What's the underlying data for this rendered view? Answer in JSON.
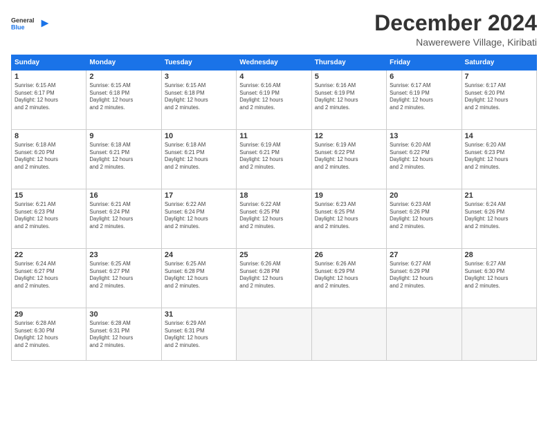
{
  "logo": {
    "general": "General",
    "blue": "Blue"
  },
  "title": {
    "month": "December 2024",
    "location": "Nawerewere Village, Kiribati"
  },
  "weekdays": [
    "Sunday",
    "Monday",
    "Tuesday",
    "Wednesday",
    "Thursday",
    "Friday",
    "Saturday"
  ],
  "weeks": [
    [
      {
        "day": "1",
        "info": "Sunrise: 6:15 AM\nSunset: 6:17 PM\nDaylight: 12 hours\nand 2 minutes."
      },
      {
        "day": "2",
        "info": "Sunrise: 6:15 AM\nSunset: 6:18 PM\nDaylight: 12 hours\nand 2 minutes."
      },
      {
        "day": "3",
        "info": "Sunrise: 6:15 AM\nSunset: 6:18 PM\nDaylight: 12 hours\nand 2 minutes."
      },
      {
        "day": "4",
        "info": "Sunrise: 6:16 AM\nSunset: 6:19 PM\nDaylight: 12 hours\nand 2 minutes."
      },
      {
        "day": "5",
        "info": "Sunrise: 6:16 AM\nSunset: 6:19 PM\nDaylight: 12 hours\nand 2 minutes."
      },
      {
        "day": "6",
        "info": "Sunrise: 6:17 AM\nSunset: 6:19 PM\nDaylight: 12 hours\nand 2 minutes."
      },
      {
        "day": "7",
        "info": "Sunrise: 6:17 AM\nSunset: 6:20 PM\nDaylight: 12 hours\nand 2 minutes."
      }
    ],
    [
      {
        "day": "8",
        "info": "Sunrise: 6:18 AM\nSunset: 6:20 PM\nDaylight: 12 hours\nand 2 minutes."
      },
      {
        "day": "9",
        "info": "Sunrise: 6:18 AM\nSunset: 6:21 PM\nDaylight: 12 hours\nand 2 minutes."
      },
      {
        "day": "10",
        "info": "Sunrise: 6:18 AM\nSunset: 6:21 PM\nDaylight: 12 hours\nand 2 minutes."
      },
      {
        "day": "11",
        "info": "Sunrise: 6:19 AM\nSunset: 6:21 PM\nDaylight: 12 hours\nand 2 minutes."
      },
      {
        "day": "12",
        "info": "Sunrise: 6:19 AM\nSunset: 6:22 PM\nDaylight: 12 hours\nand 2 minutes."
      },
      {
        "day": "13",
        "info": "Sunrise: 6:20 AM\nSunset: 6:22 PM\nDaylight: 12 hours\nand 2 minutes."
      },
      {
        "day": "14",
        "info": "Sunrise: 6:20 AM\nSunset: 6:23 PM\nDaylight: 12 hours\nand 2 minutes."
      }
    ],
    [
      {
        "day": "15",
        "info": "Sunrise: 6:21 AM\nSunset: 6:23 PM\nDaylight: 12 hours\nand 2 minutes."
      },
      {
        "day": "16",
        "info": "Sunrise: 6:21 AM\nSunset: 6:24 PM\nDaylight: 12 hours\nand 2 minutes."
      },
      {
        "day": "17",
        "info": "Sunrise: 6:22 AM\nSunset: 6:24 PM\nDaylight: 12 hours\nand 2 minutes."
      },
      {
        "day": "18",
        "info": "Sunrise: 6:22 AM\nSunset: 6:25 PM\nDaylight: 12 hours\nand 2 minutes."
      },
      {
        "day": "19",
        "info": "Sunrise: 6:23 AM\nSunset: 6:25 PM\nDaylight: 12 hours\nand 2 minutes."
      },
      {
        "day": "20",
        "info": "Sunrise: 6:23 AM\nSunset: 6:26 PM\nDaylight: 12 hours\nand 2 minutes."
      },
      {
        "day": "21",
        "info": "Sunrise: 6:24 AM\nSunset: 6:26 PM\nDaylight: 12 hours\nand 2 minutes."
      }
    ],
    [
      {
        "day": "22",
        "info": "Sunrise: 6:24 AM\nSunset: 6:27 PM\nDaylight: 12 hours\nand 2 minutes."
      },
      {
        "day": "23",
        "info": "Sunrise: 6:25 AM\nSunset: 6:27 PM\nDaylight: 12 hours\nand 2 minutes."
      },
      {
        "day": "24",
        "info": "Sunrise: 6:25 AM\nSunset: 6:28 PM\nDaylight: 12 hours\nand 2 minutes."
      },
      {
        "day": "25",
        "info": "Sunrise: 6:26 AM\nSunset: 6:28 PM\nDaylight: 12 hours\nand 2 minutes."
      },
      {
        "day": "26",
        "info": "Sunrise: 6:26 AM\nSunset: 6:29 PM\nDaylight: 12 hours\nand 2 minutes."
      },
      {
        "day": "27",
        "info": "Sunrise: 6:27 AM\nSunset: 6:29 PM\nDaylight: 12 hours\nand 2 minutes."
      },
      {
        "day": "28",
        "info": "Sunrise: 6:27 AM\nSunset: 6:30 PM\nDaylight: 12 hours\nand 2 minutes."
      }
    ],
    [
      {
        "day": "29",
        "info": "Sunrise: 6:28 AM\nSunset: 6:30 PM\nDaylight: 12 hours\nand 2 minutes."
      },
      {
        "day": "30",
        "info": "Sunrise: 6:28 AM\nSunset: 6:31 PM\nDaylight: 12 hours\nand 2 minutes."
      },
      {
        "day": "31",
        "info": "Sunrise: 6:29 AM\nSunset: 6:31 PM\nDaylight: 12 hours\nand 2 minutes."
      },
      {
        "day": "",
        "info": ""
      },
      {
        "day": "",
        "info": ""
      },
      {
        "day": "",
        "info": ""
      },
      {
        "day": "",
        "info": ""
      }
    ]
  ]
}
